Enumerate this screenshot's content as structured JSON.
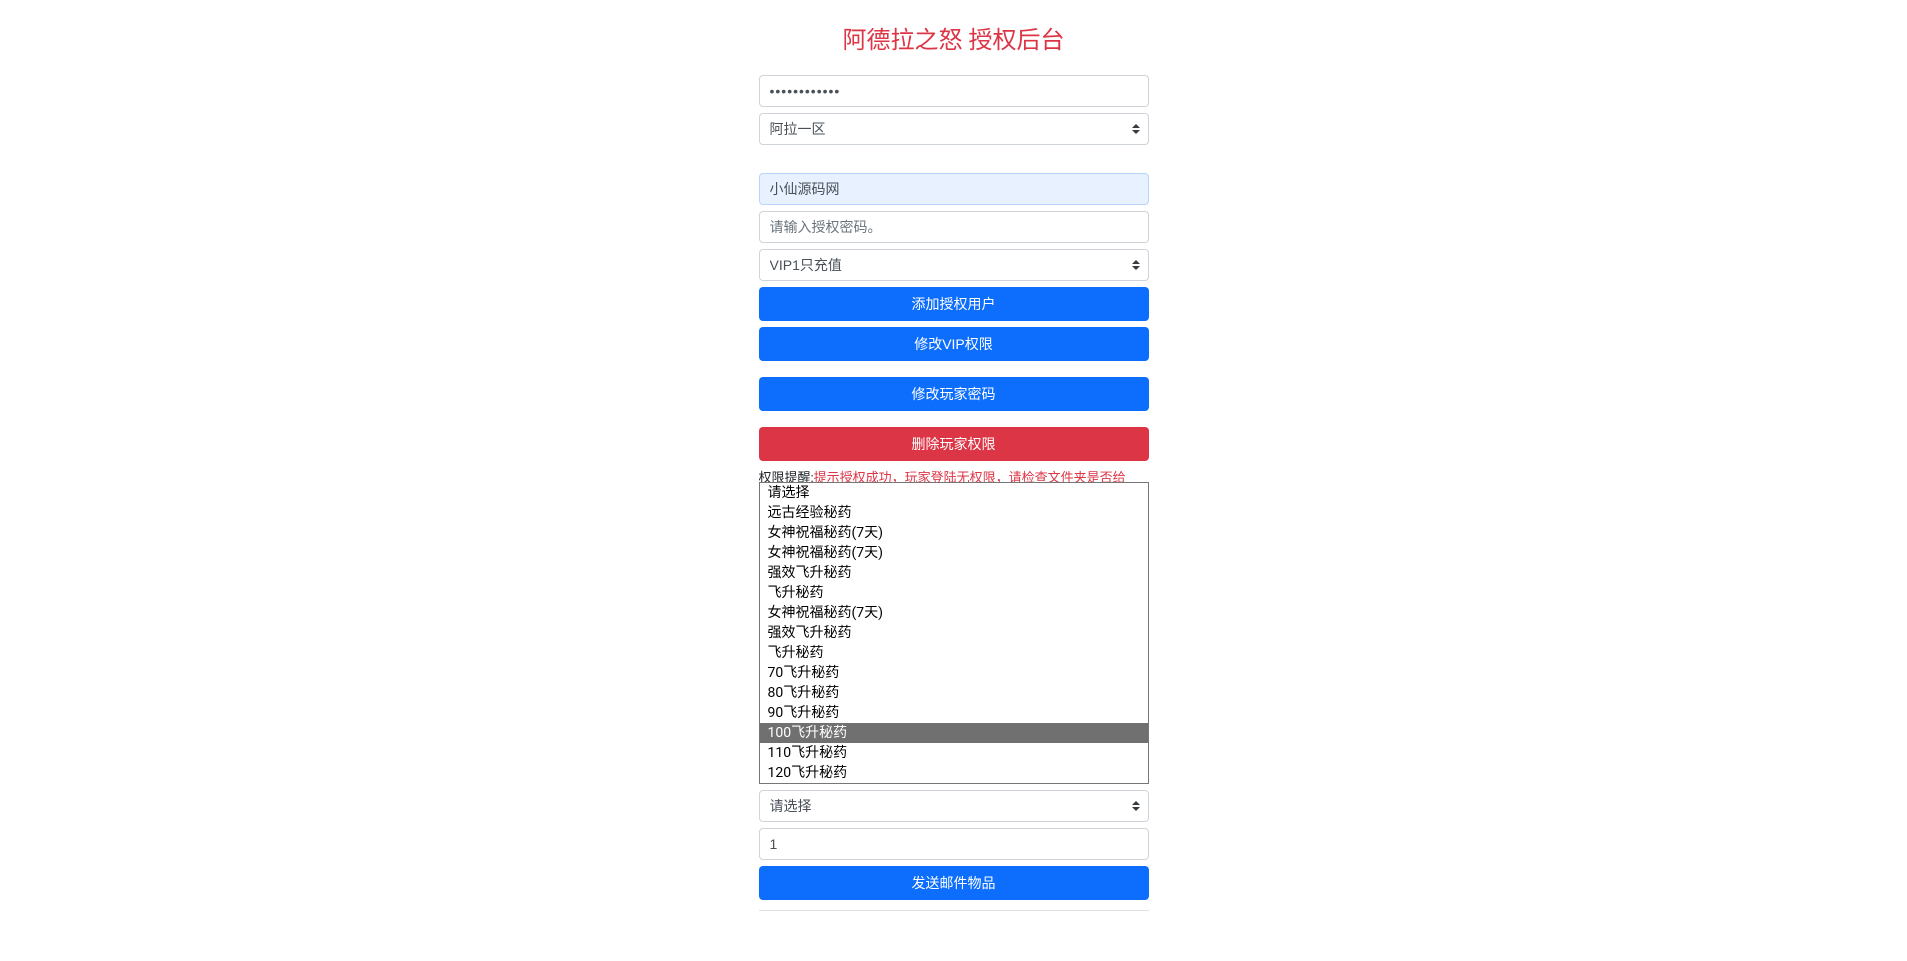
{
  "title": "阿德拉之怒 授权后台",
  "password_field": {
    "value": "••••••••••••"
  },
  "region_select": {
    "selected": "阿拉一区"
  },
  "auth_section": {
    "username_value": "小仙源码网",
    "password_placeholder": "请输入授权密码。",
    "vip_select_selected": "VIP1只充值",
    "btn_add_user": "添加授权用户",
    "btn_modify_vip": "修改VIP权限",
    "btn_modify_password": "修改玩家密码",
    "btn_delete_permission": "删除玩家权限"
  },
  "warning": {
    "label": "权限提醒:",
    "text": "提示授权成功，玩家登陆无权限，请检查文件夹是否给"
  },
  "item_dropdown": {
    "options": [
      "请选择",
      "远古经验秘药",
      "女神祝福秘药(7天)",
      "女神祝福秘药(7天)",
      "强效飞升秘药",
      "飞升秘药",
      "女神祝福秘药(7天)",
      "强效飞升秘药",
      "飞升秘药",
      "70飞升秘药",
      "80飞升秘药",
      "90飞升秘药",
      "100飞升秘药",
      "110飞升秘药",
      "120飞升秘药"
    ],
    "highlighted_index": 12
  },
  "mail_section": {
    "select_placeholder": "请选择",
    "quantity_value": "1",
    "btn_send_mail": "发送邮件物品"
  }
}
